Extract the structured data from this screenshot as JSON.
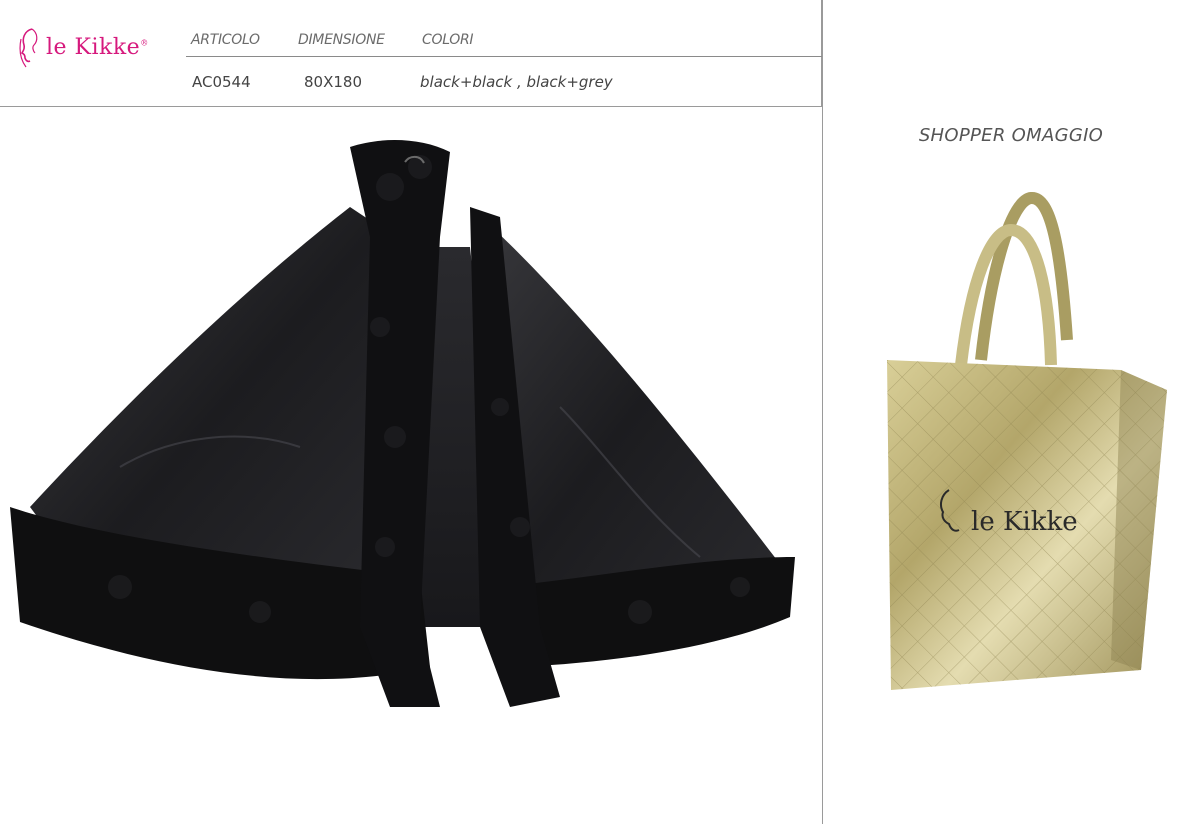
{
  "brand": {
    "name": "le Kikke",
    "reg": "®"
  },
  "table": {
    "headers": [
      "ARTICOLO",
      "DIMENSIONE",
      "COLORI"
    ],
    "values": [
      "AC0544",
      "80X180",
      "black+black , black+grey"
    ]
  },
  "side_panel": {
    "label": "SHOPPER OMAGGIO"
  },
  "bag_logo_text": "le Kikke",
  "colors": {
    "brand_pink": "#d6197d",
    "cape": "#1e1e20",
    "bag_gold": "#b9ad73"
  }
}
